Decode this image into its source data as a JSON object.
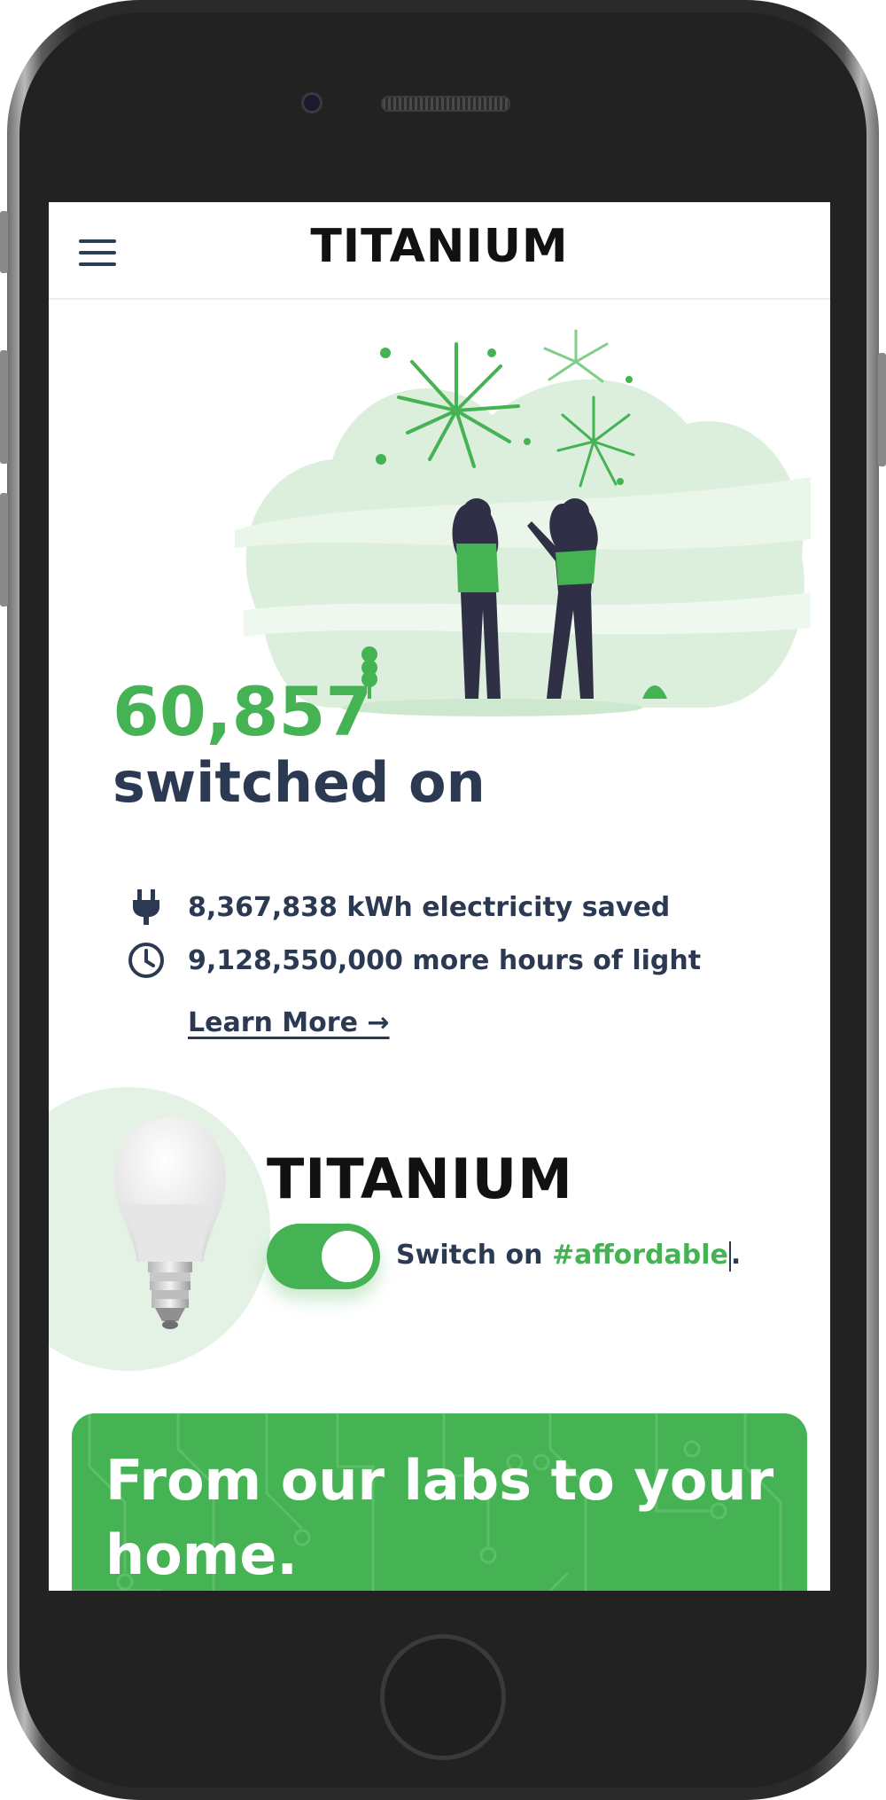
{
  "header": {
    "logo": "TITANIUM",
    "menu_icon": "hamburger-menu-icon"
  },
  "hero": {
    "count": "60,857",
    "subtitle": "switched on",
    "illustration": "fireworks-celebration-illustration"
  },
  "stats": [
    {
      "icon": "plug-icon",
      "text": "8,367,838 kWh electricity saved"
    },
    {
      "icon": "clock-icon",
      "text": "9,128,550,000 more hours of light"
    }
  ],
  "learn_more": "Learn More →",
  "product": {
    "brand": "TITANIUM",
    "switch_prefix": "Switch on ",
    "switch_hashtag": "#affordable",
    "switch_suffix": ".",
    "toggle_on": true
  },
  "lab_banner": {
    "heading": "From our labs to your home."
  },
  "colors": {
    "accent": "#45b354",
    "text_dark": "#2b3a52",
    "light_green": "#e3f2e4"
  }
}
